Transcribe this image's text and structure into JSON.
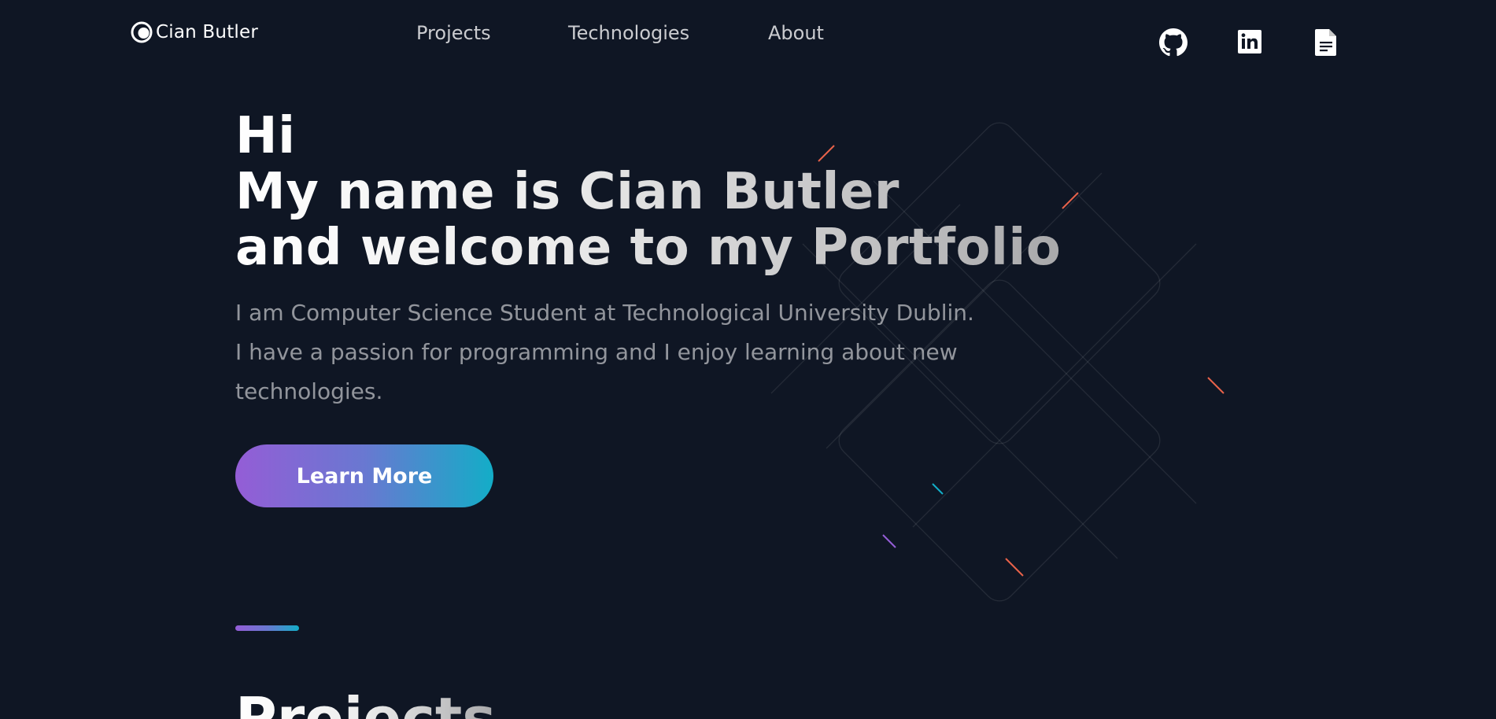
{
  "header": {
    "logo_text": "Cian Butler",
    "logo_icon": "crescent-circle-icon",
    "nav": [
      {
        "label": "Projects"
      },
      {
        "label": "Technologies"
      },
      {
        "label": "About"
      }
    ],
    "social": [
      {
        "icon": "github-icon"
      },
      {
        "icon": "linkedin-icon"
      },
      {
        "icon": "resume-document-icon"
      }
    ]
  },
  "hero": {
    "title_lines": [
      "Hi",
      "My name is Cian Butler",
      "and welcome to my Portfolio"
    ],
    "description_lines": [
      "I am Computer Science Student at Technological University Dublin.",
      "I have a passion for programming and I enjoy learning about new",
      "technologies."
    ],
    "cta_label": "Learn More"
  },
  "projects_section": {
    "title": "Projects"
  },
  "colors": {
    "background": "#0f1624",
    "gradient_start": "#945dd6",
    "gradient_mid": "#6978d1",
    "gradient_end": "#13adc7",
    "text_primary": "#ffffff"
  }
}
